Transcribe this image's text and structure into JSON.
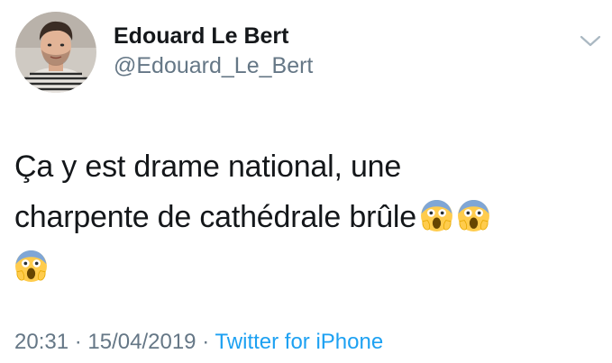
{
  "author": {
    "name": "Edouard Le Bert",
    "handle": "@Edouard_Le_Bert"
  },
  "tweet": {
    "line1": "Ça y est drame national, une",
    "line2": "charpente de cathédrale brûle",
    "emojis": [
      "face-screaming-in-fear-emoji",
      "face-screaming-in-fear-emoji",
      "face-screaming-in-fear-emoji"
    ]
  },
  "meta": {
    "time": "20:31",
    "separator": "·",
    "date": "15/04/2019",
    "source": "Twitter for iPhone"
  },
  "icons": {
    "more": "chevron-down-icon"
  },
  "colors": {
    "text": "#14171a",
    "secondary": "#657786",
    "link": "#1da1f2"
  }
}
